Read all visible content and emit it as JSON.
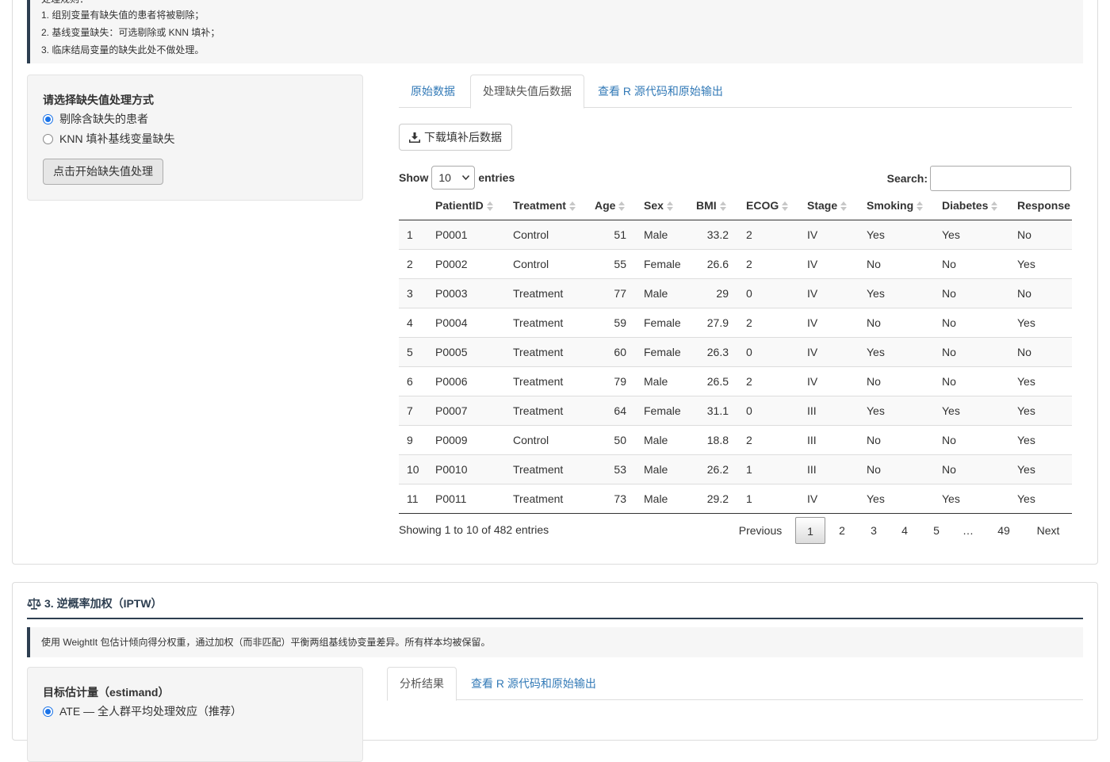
{
  "section2": {
    "rules_heading": "处理规则：",
    "rules": [
      "1. 组别变量有缺失值的患者将被剔除；",
      "2. 基线变量缺失：可选剔除或 KNN 填补；",
      "3. 临床结局变量的缺失此处不做处理。"
    ],
    "sidebar": {
      "label": "请选择缺失值处理方式",
      "options": [
        {
          "label": "剔除含缺失的患者",
          "checked": true
        },
        {
          "label": "KNN 填补基线变量缺失",
          "checked": false
        }
      ],
      "button": "点击开始缺失值处理"
    },
    "tabs": [
      {
        "label": "原始数据",
        "active": false
      },
      {
        "label": "处理缺失值后数据",
        "active": true
      },
      {
        "label": "查看 R 源代码和原始输出",
        "active": false
      }
    ],
    "download_button": "下载填补后数据",
    "table": {
      "show_label": "Show",
      "length_value": "10",
      "entries_label": "entries",
      "search_label": "Search:",
      "search_value": "",
      "columns": [
        "",
        "PatientID",
        "Treatment",
        "Age",
        "Sex",
        "BMI",
        "ECOG",
        "Stage",
        "Smoking",
        "Diabetes",
        "Response"
      ],
      "rows": [
        [
          "1",
          "P0001",
          "Control",
          "51",
          "Male",
          "33.2",
          "2",
          "IV",
          "Yes",
          "Yes",
          "No"
        ],
        [
          "2",
          "P0002",
          "Control",
          "55",
          "Female",
          "26.6",
          "2",
          "IV",
          "No",
          "No",
          "Yes"
        ],
        [
          "3",
          "P0003",
          "Treatment",
          "77",
          "Male",
          "29",
          "0",
          "IV",
          "Yes",
          "No",
          "No"
        ],
        [
          "4",
          "P0004",
          "Treatment",
          "59",
          "Female",
          "27.9",
          "2",
          "IV",
          "No",
          "No",
          "Yes"
        ],
        [
          "5",
          "P0005",
          "Treatment",
          "60",
          "Female",
          "26.3",
          "0",
          "IV",
          "Yes",
          "No",
          "No"
        ],
        [
          "6",
          "P0006",
          "Treatment",
          "79",
          "Male",
          "26.5",
          "2",
          "IV",
          "No",
          "No",
          "Yes"
        ],
        [
          "7",
          "P0007",
          "Treatment",
          "64",
          "Female",
          "31.1",
          "0",
          "III",
          "Yes",
          "Yes",
          "Yes"
        ],
        [
          "9",
          "P0009",
          "Control",
          "50",
          "Male",
          "18.8",
          "2",
          "III",
          "No",
          "No",
          "Yes"
        ],
        [
          "10",
          "P0010",
          "Treatment",
          "53",
          "Male",
          "26.2",
          "1",
          "III",
          "No",
          "No",
          "Yes"
        ],
        [
          "11",
          "P0011",
          "Treatment",
          "73",
          "Male",
          "29.2",
          "1",
          "IV",
          "Yes",
          "Yes",
          "Yes"
        ]
      ],
      "info": "Showing 1 to 10 of 482 entries",
      "pagination": {
        "previous": "Previous",
        "pages": [
          "1",
          "2",
          "3",
          "4",
          "5",
          "…",
          "49"
        ],
        "current": "1",
        "next": "Next"
      }
    }
  },
  "section3": {
    "title": "3. 逆概率加权（IPTW）",
    "note": "使用 WeightIt 包估计倾向得分权重，通过加权（而非匹配）平衡两组基线协变量差异。所有样本均被保留。",
    "sidebar": {
      "label": "目标估计量（estimand）",
      "option1": "ATE — 全人群平均处理效应（推荐）"
    },
    "tabs": [
      {
        "label": "分析结果",
        "active": true
      },
      {
        "label": "查看 R 源代码和原始输出",
        "active": false
      }
    ]
  },
  "colors": {
    "accent": "#2d3e50",
    "link": "#337ab7",
    "radio": "#1a73e8"
  },
  "icons": [
    "download-icon",
    "balance-scale-icon",
    "sort-icon"
  ]
}
